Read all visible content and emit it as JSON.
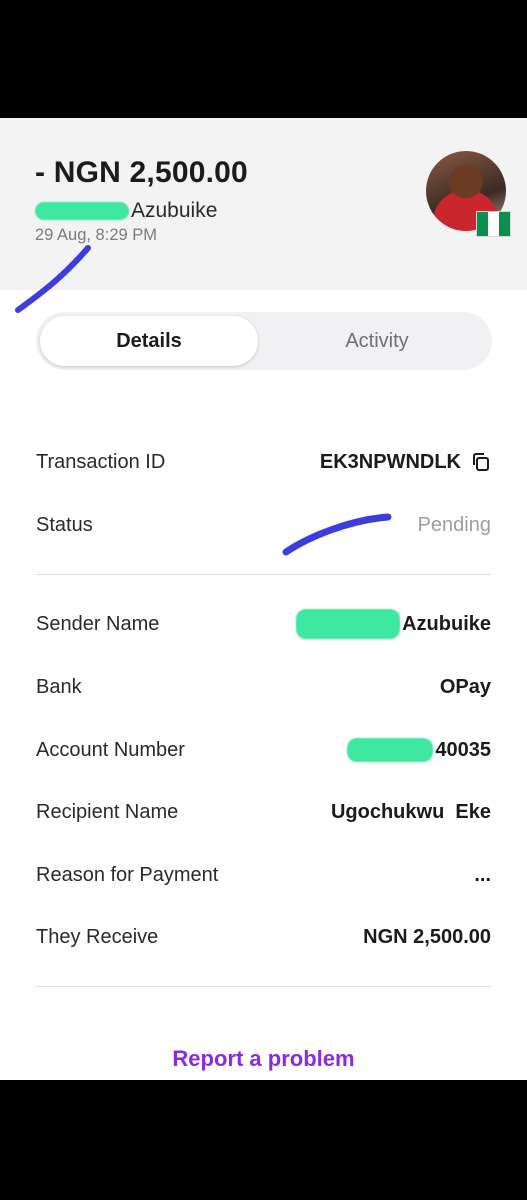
{
  "header": {
    "amount": "- NGN 2,500.00",
    "name_visible": "Azubuike",
    "date": "29 Aug, 8:29 PM",
    "avatar_icon": "user-avatar-photo",
    "flag_icon": "nigeria-flag-icon"
  },
  "tabs": [
    {
      "label": "Details",
      "active": true
    },
    {
      "label": "Activity",
      "active": false
    }
  ],
  "details": {
    "transaction_id": {
      "label": "Transaction ID",
      "value": "EK3NPWNDLK"
    },
    "status": {
      "label": "Status",
      "value": "Pending"
    },
    "sender_name": {
      "label": "Sender Name",
      "value": "Azubuike"
    },
    "bank": {
      "label": "Bank",
      "value": "OPay"
    },
    "account_number": {
      "label": "Account Number",
      "value": "40035"
    },
    "recipient_name": {
      "label": "Recipient Name",
      "value": "Ugochukwu  Eke"
    },
    "reason": {
      "label": "Reason for Payment",
      "value": "..."
    },
    "they_receive": {
      "label": "They Receive",
      "value": "NGN 2,500.00"
    }
  },
  "footer": {
    "report_label": "Report a problem"
  },
  "colors": {
    "accent": "#8a2be2",
    "redaction": "#3ee8a0",
    "scribble": "#3c3ce0",
    "flag_green": "#0a8f4f"
  }
}
